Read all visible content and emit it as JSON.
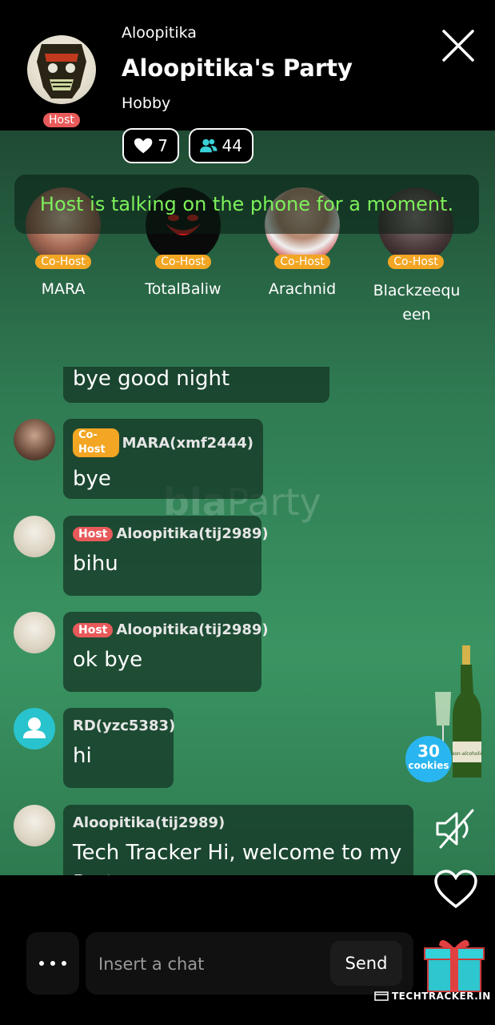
{
  "header": {
    "username": "Aloopitika",
    "title": "Aloopitika's Party",
    "category": "Hobby",
    "host_badge": "Host",
    "likes": "7",
    "viewers": "44"
  },
  "notice": "Host is talking on the phone for a moment.",
  "watermark": {
    "bold": "bla",
    "light": "Party"
  },
  "cohosts": [
    {
      "badge": "Co-Host",
      "name": "MARA"
    },
    {
      "badge": "Co-Host",
      "name": "TotalBaliw"
    },
    {
      "badge": "Co-Host",
      "name": "Arachnid"
    },
    {
      "badge": "Co-Host",
      "name": "Blackzeequeen"
    }
  ],
  "messages": [
    {
      "badge": "",
      "sender": "",
      "text": "bye good night"
    },
    {
      "badge": "Co-Host",
      "sender": "MARA(xmf2444)",
      "text": "bye"
    },
    {
      "badge": "Host",
      "sender": "Aloopitika(tij2989)",
      "text": "bihu"
    },
    {
      "badge": "Host",
      "sender": "Aloopitika(tij2989)",
      "text": "ok bye"
    },
    {
      "badge": "",
      "sender": "RD(yzc5383)",
      "text": "hi"
    },
    {
      "badge": "",
      "sender": "Aloopitika(tij2989)",
      "text": "Tech Tracker Hi, welcome to my Party."
    }
  ],
  "cookies": {
    "count": "30",
    "label": "cookies"
  },
  "bottle_label": "Non-alcoholic",
  "chat": {
    "placeholder": "Insert a chat",
    "send_label": "Send"
  },
  "footer_watermark": "TECHTRACKER.IN",
  "colors": {
    "host_badge": "#e85a5a",
    "cohost_badge": "#f2a623",
    "notice_text": "#7df05a",
    "accent_teal": "#29c3cd"
  },
  "icons": [
    "close-icon",
    "heart-icon",
    "people-icon",
    "mute-icon",
    "gift-icon",
    "more-icon"
  ]
}
